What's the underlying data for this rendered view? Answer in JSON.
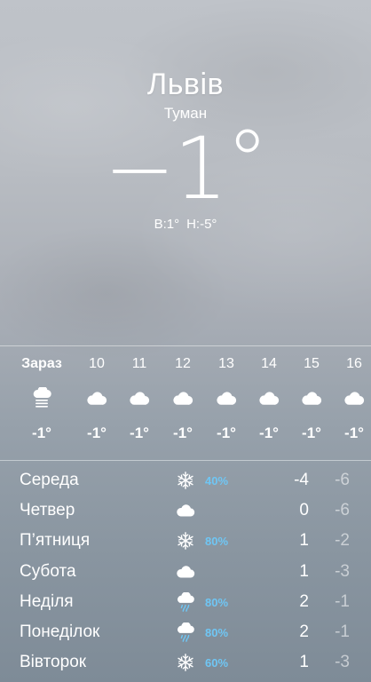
{
  "current": {
    "city": "Львів",
    "condition": "Туман",
    "temperature": "−1",
    "degree_symbol": "°",
    "high": "В:1°",
    "low": "Н:-5°"
  },
  "hourly": [
    {
      "time": "Зараз",
      "icon": "fog-icon",
      "temp": "-1°"
    },
    {
      "time": "10",
      "icon": "cloud-icon",
      "temp": "-1°"
    },
    {
      "time": "11",
      "icon": "cloud-icon",
      "temp": "-1°"
    },
    {
      "time": "12",
      "icon": "cloud-icon",
      "temp": "-1°"
    },
    {
      "time": "13",
      "icon": "cloud-icon",
      "temp": "-1°"
    },
    {
      "time": "14",
      "icon": "cloud-icon",
      "temp": "-1°"
    },
    {
      "time": "15",
      "icon": "cloud-icon",
      "temp": "-1°"
    },
    {
      "time": "16",
      "icon": "cloud-icon",
      "temp": "-1°"
    }
  ],
  "daily": [
    {
      "day": "Середа",
      "icon": "snowflake-icon",
      "precip": "40%",
      "high": "-4",
      "low": "-6"
    },
    {
      "day": "Четвер",
      "icon": "cloud-icon",
      "precip": "",
      "high": "0",
      "low": "-6"
    },
    {
      "day": "П’ятниця",
      "icon": "snowflake-icon",
      "precip": "80%",
      "high": "1",
      "low": "-2"
    },
    {
      "day": "Субота",
      "icon": "cloud-icon",
      "precip": "",
      "high": "1",
      "low": "-3"
    },
    {
      "day": "Неділя",
      "icon": "cloud-rain-icon",
      "precip": "80%",
      "high": "2",
      "low": "-1"
    },
    {
      "day": "Понеділок",
      "icon": "cloud-rain-icon",
      "precip": "80%",
      "high": "2",
      "low": "-1"
    },
    {
      "day": "Вівторок",
      "icon": "snowflake-icon",
      "precip": "60%",
      "high": "1",
      "low": "-3"
    }
  ],
  "colors": {
    "precip_text": "#6fc6f4",
    "low_text": "rgba(255,255,255,0.55)"
  }
}
